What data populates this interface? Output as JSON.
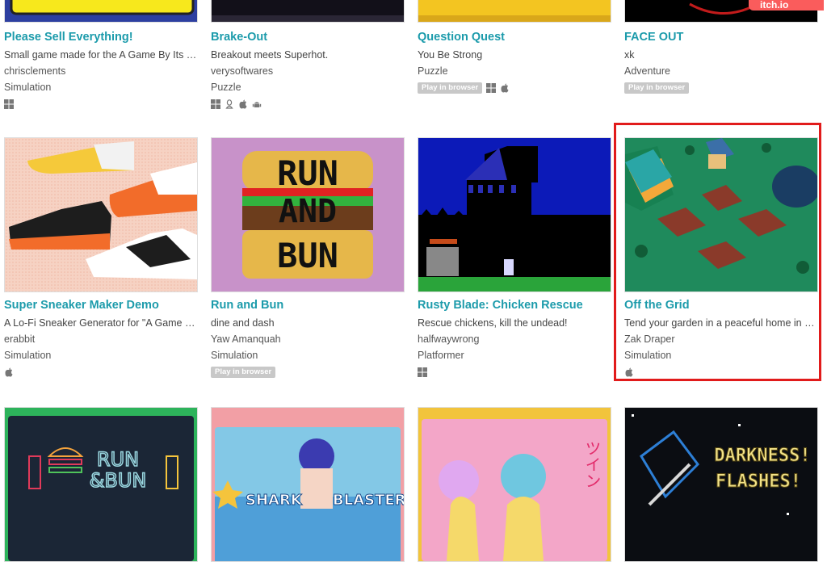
{
  "games": [
    {
      "title": "Please Sell Everything!",
      "description": "Small game made for the A Game By Its C...",
      "author": "chrisclements",
      "genre": "Simulation",
      "badge": "",
      "platforms": [
        "windows-icon"
      ]
    },
    {
      "title": "Brake-Out",
      "description": "Breakout meets Superhot.",
      "author": "verysoftwares",
      "genre": "Puzzle",
      "badge": "",
      "platforms": [
        "windows-icon",
        "linux-icon",
        "apple-icon",
        "android-icon"
      ]
    },
    {
      "title": "Question Quest",
      "description": "You Be Strong",
      "author": "",
      "genre": "Puzzle",
      "badge": "Play in browser",
      "platforms": [
        "windows-icon",
        "apple-icon"
      ]
    },
    {
      "title": "FACE OUT",
      "description": "xk",
      "author": "",
      "genre": "Adventure",
      "badge": "Play in browser",
      "platforms": []
    },
    {
      "title": "Super Sneaker Maker Demo",
      "description": "A Lo-Fi Sneaker Generator for \"A Game B...",
      "author": "erabbit",
      "genre": "Simulation",
      "badge": "",
      "platforms": [
        "apple-icon"
      ]
    },
    {
      "title": "Run and Bun",
      "description": "dine and dash",
      "author": "Yaw Amanquah",
      "genre": "Simulation",
      "badge": "Play in browser",
      "platforms": []
    },
    {
      "title": "Rusty Blade: Chicken Rescue",
      "description": "Rescue chickens, kill the undead!",
      "author": "halfwaywrong",
      "genre": "Platformer",
      "badge": "",
      "platforms": [
        "windows-icon"
      ]
    },
    {
      "title": "Off the Grid",
      "description": "Tend your garden in a peaceful home in a ...",
      "author": "Zak Draper",
      "genre": "Simulation",
      "badge": "",
      "platforms": [
        "apple-icon"
      ]
    }
  ],
  "itch_badge": "itch.io"
}
